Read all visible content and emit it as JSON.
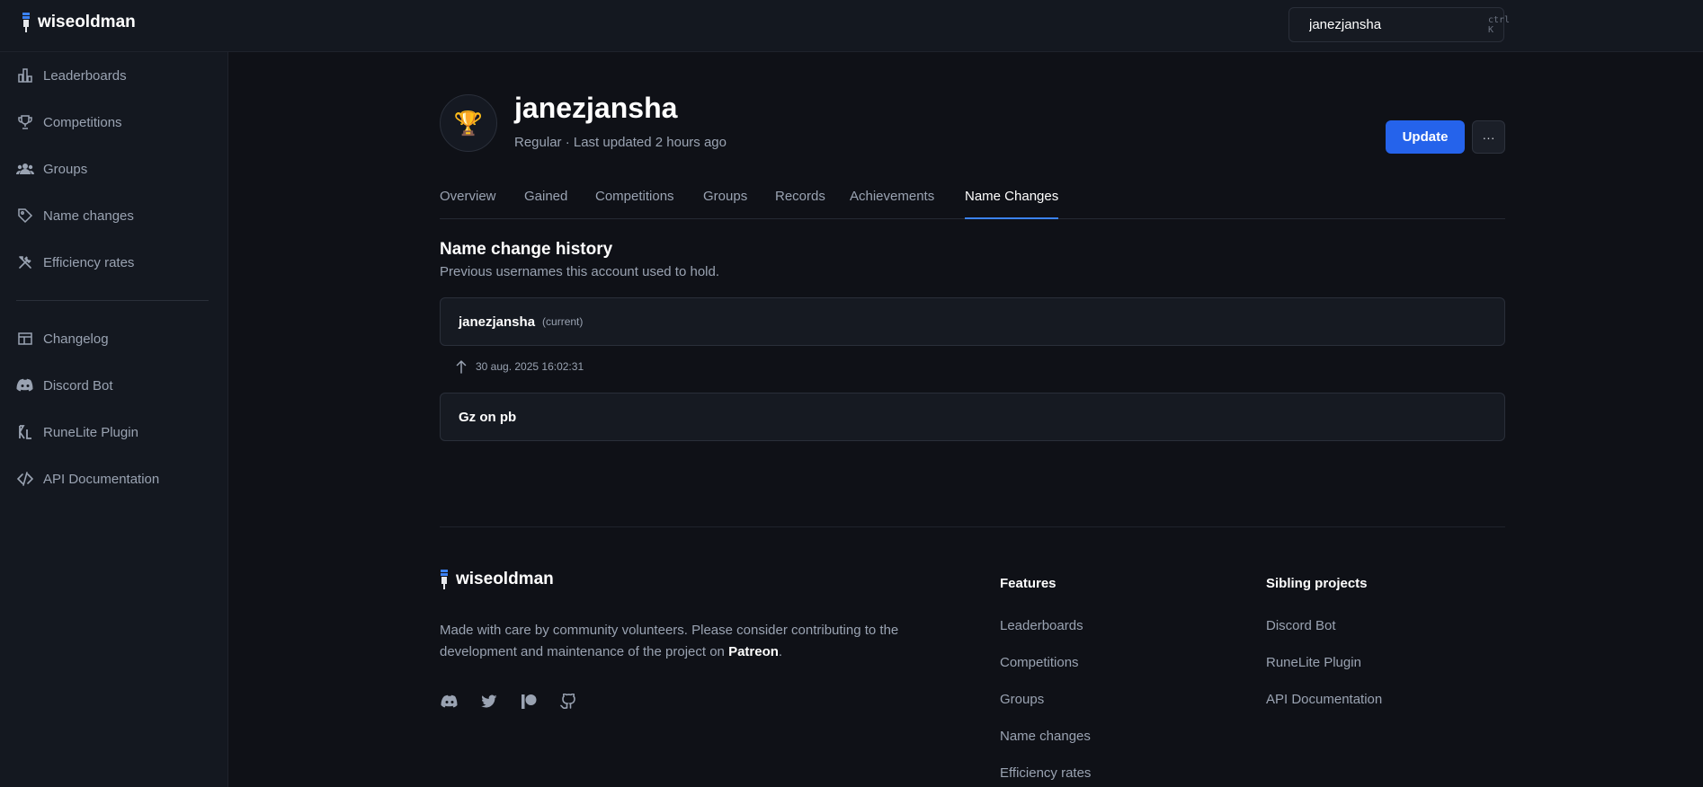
{
  "app": {
    "name": "wiseoldman"
  },
  "search": {
    "value": "janezjansha",
    "shortcut": "ctrl K"
  },
  "sidebar": {
    "items": [
      {
        "label": "Leaderboards",
        "icon": "bar-chart-icon"
      },
      {
        "label": "Competitions",
        "icon": "trophy-icon"
      },
      {
        "label": "Groups",
        "icon": "users-icon"
      },
      {
        "label": "Name changes",
        "icon": "tag-icon"
      },
      {
        "label": "Efficiency rates",
        "icon": "tools-icon"
      }
    ],
    "secondary": [
      {
        "label": "Changelog",
        "icon": "layout-icon"
      },
      {
        "label": "Discord Bot",
        "icon": "discord-icon"
      },
      {
        "label": "RuneLite Plugin",
        "icon": "runelite-icon"
      },
      {
        "label": "API Documentation",
        "icon": "code-icon"
      }
    ]
  },
  "player": {
    "name": "janezjansha",
    "meta": "Regular · Last updated 2 hours ago",
    "update_label": "Update",
    "more_label": "···"
  },
  "tabs": [
    "Overview",
    "Gained",
    "Competitions",
    "Groups",
    "Records",
    "Achievements",
    "Name Changes"
  ],
  "active_tab": "Name Changes",
  "history": {
    "title": "Name change history",
    "subtitle": "Previous usernames this account used to hold.",
    "current": {
      "name": "janezjansha",
      "tag": "(current)"
    },
    "change_date": "30 aug. 2025 16:02:31",
    "previous": {
      "name": "Gz on pb"
    }
  },
  "footer": {
    "brand": "wiseoldman",
    "desc_prefix": "Made with care by community volunteers. Please consider contributing to the development and maintenance of the project on ",
    "desc_link": "Patreon",
    "desc_suffix": ".",
    "social": [
      "discord-icon",
      "twitter-icon",
      "patreon-icon",
      "github-icon"
    ],
    "features_title": "Features",
    "features": [
      "Leaderboards",
      "Competitions",
      "Groups",
      "Name changes",
      "Efficiency rates"
    ],
    "siblings_title": "Sibling projects",
    "siblings": [
      "Discord Bot",
      "RuneLite Plugin",
      "API Documentation"
    ]
  },
  "colors": {
    "accent": "#2563eb",
    "tab_underline": "#3b82f6",
    "background": "#0f1117",
    "panel": "#141820"
  }
}
